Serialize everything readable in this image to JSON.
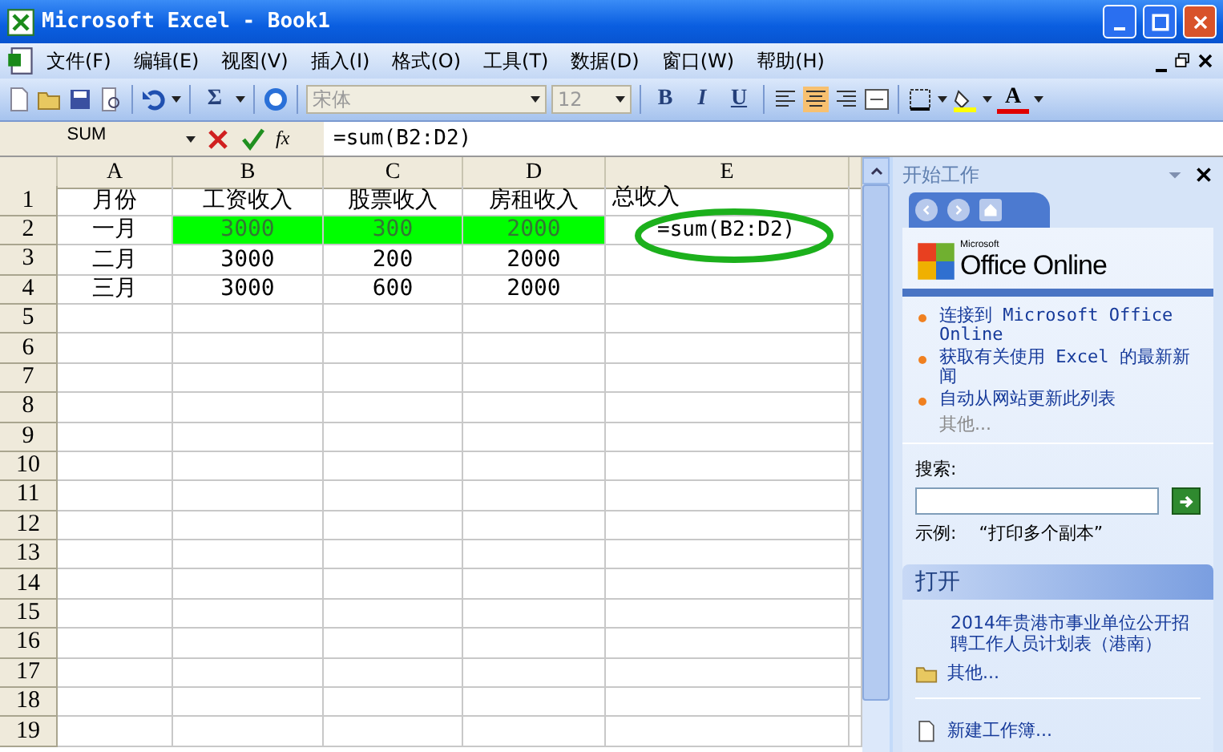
{
  "window": {
    "title": "Microsoft Excel - Book1"
  },
  "menu": [
    "文件(F)",
    "编辑(E)",
    "视图(V)",
    "插入(I)",
    "格式(O)",
    "工具(T)",
    "数据(D)",
    "窗口(W)",
    "帮助(H)"
  ],
  "toolbar": {
    "autosum": "Σ",
    "font": "宋体",
    "font_size": "12",
    "bold": "B",
    "italic": "I",
    "underline": "U",
    "font_color": "A"
  },
  "formula_bar": {
    "name_box": "SUM",
    "fx": "fx",
    "formula": "=sum(B2:D2)"
  },
  "sheet": {
    "columns": [
      "A",
      "B",
      "C",
      "D",
      "E"
    ],
    "rows": [
      {
        "header": "1",
        "cells": [
          {
            "text": "月份",
            "highlighted": false
          },
          {
            "text": "工资收入",
            "highlighted": false
          },
          {
            "text": "股票收入",
            "highlighted": false
          },
          {
            "text": "房租收入",
            "highlighted": false
          },
          {
            "text": "总收入",
            "highlighted": false
          }
        ]
      },
      {
        "header": "2",
        "cells": [
          {
            "text": "一月",
            "highlighted": false
          },
          {
            "text": "3000",
            "highlighted": true
          },
          {
            "text": "300",
            "highlighted": true
          },
          {
            "text": "2000",
            "highlighted": true
          },
          {
            "text": "=sum(B2:D2)",
            "highlighted": false
          }
        ]
      },
      {
        "header": "3",
        "cells": [
          {
            "text": "二月",
            "highlighted": false
          },
          {
            "text": "3000",
            "highlighted": false
          },
          {
            "text": "200",
            "highlighted": false
          },
          {
            "text": "2000",
            "highlighted": false
          }
        ]
      },
      {
        "header": "4",
        "cells": [
          {
            "text": "三月",
            "highlighted": false
          },
          {
            "text": "3000",
            "highlighted": false
          },
          {
            "text": "600",
            "highlighted": false
          },
          {
            "text": "2000",
            "highlighted": false
          }
        ]
      },
      {
        "header": "5"
      },
      {
        "header": "6"
      },
      {
        "header": "7"
      },
      {
        "header": "8"
      },
      {
        "header": "9"
      },
      {
        "header": "10"
      },
      {
        "header": "11"
      },
      {
        "header": "12"
      },
      {
        "header": "13"
      },
      {
        "header": "14"
      },
      {
        "header": "15"
      },
      {
        "header": "16"
      },
      {
        "header": "17"
      },
      {
        "header": "18"
      },
      {
        "header": "19"
      }
    ]
  },
  "task_pane": {
    "title": "开始工作",
    "logo_small": "Microsoft",
    "logo": "Office Online",
    "links": [
      "连接到 Microsoft Office Online",
      "获取有关使用 Excel 的最新新闻",
      "自动从网站更新此列表"
    ],
    "more": "其他...",
    "search_label": "搜索:",
    "search_example_label": "示例:",
    "search_example": "“打印多个副本”",
    "open_section": {
      "title": "打开",
      "files": [
        "2014年贵港市事业单位公开招聘工作人员计划表（港南）"
      ],
      "more": "其他...",
      "new_workbook": "新建工作簿..."
    }
  }
}
